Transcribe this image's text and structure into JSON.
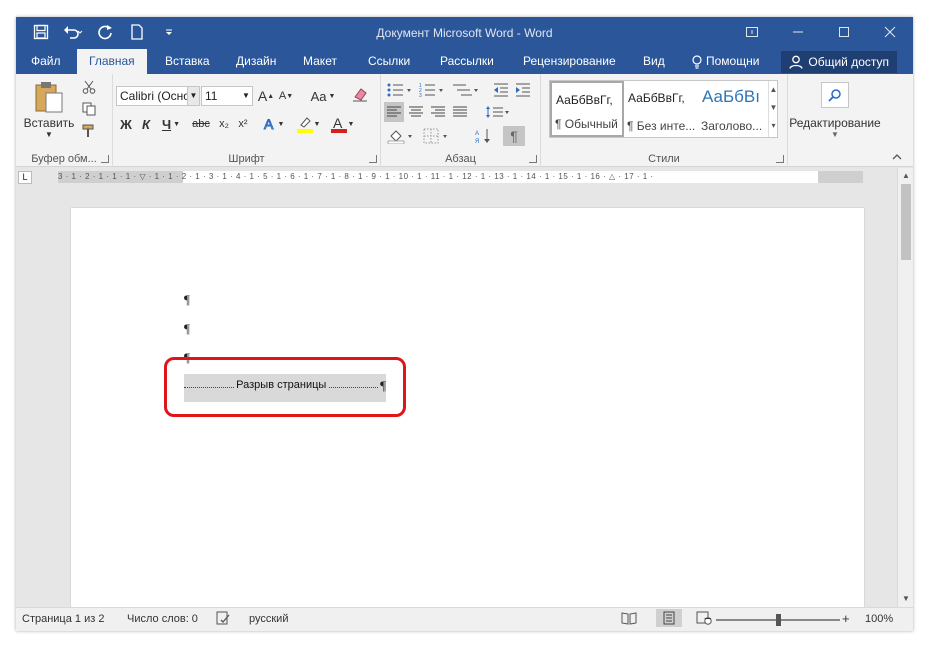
{
  "titlebar": {
    "title": "Документ Microsoft Word - Word",
    "qat_icons": [
      "save-icon",
      "undo-icon",
      "redo-icon",
      "new-document-icon",
      "customize-qat-icon"
    ],
    "window_controls": [
      "ribbon-display-icon",
      "minimize-icon",
      "maximize-icon",
      "close-icon"
    ]
  },
  "tabs": [
    "Файл",
    "Главная",
    "Вставка",
    "Дизайн",
    "Макет",
    "Ссылки",
    "Рассылки",
    "Рецензирование",
    "Вид"
  ],
  "active_tab": "Главная",
  "tell_me": "Помощни",
  "share": "Общий доступ",
  "ribbon": {
    "clipboard": {
      "paste": "Вставить",
      "label": "Буфер обм..."
    },
    "font": {
      "font_name": "Calibri (Осно",
      "font_size": "11",
      "bold": "Ж",
      "italic": "К",
      "underline": "Ч",
      "strike": "abc",
      "sub": "x₂",
      "sup": "x²",
      "grow": "A",
      "shrink": "A",
      "case": "Aa",
      "label": "Шрифт"
    },
    "paragraph": {
      "label": "Абзац",
      "pilcrow": "¶"
    },
    "styles": {
      "items": [
        {
          "sample": "АаБбВвГг,",
          "name": "¶ Обычный"
        },
        {
          "sample": "АаБбВвГг,",
          "name": "¶ Без инте..."
        },
        {
          "sample": "АаБбВı",
          "name": "Заголово..."
        }
      ],
      "label": "Стили"
    },
    "editing": {
      "label": "Редактирование"
    }
  },
  "ruler": {
    "corner": "L",
    "ticks": "3 · 1 · 2 · 1 · 1 · 1 · ▽ · 1 · 1 · 2 · 1 · 3 · 1 · 4 · 1 · 5 · 1 · 6 · 1 · 7 · 1 · 8 · 1 · 9 · 1 · 10 · 1 · 11 · 1 · 12 · 1 · 13 · 1 · 14 · 1 · 15 · 1 · 16 · △ · 17 · 1 ·"
  },
  "document": {
    "paragraph_mark": "¶",
    "page_break_text": "Разрыв страницы",
    "page_break_mark": "¶"
  },
  "status": {
    "page": "Страница 1 из 2",
    "words": "Число слов: 0",
    "language": "русский",
    "zoom_minus": "−",
    "zoom_plus": "+",
    "zoom": "100%",
    "zoom_fraction": 0.5
  },
  "colors": {
    "word_blue": "#2b579a",
    "highlight_red": "#e0141b",
    "font_color_red": "#d32020",
    "highlight_yellow": "#ffff00"
  }
}
